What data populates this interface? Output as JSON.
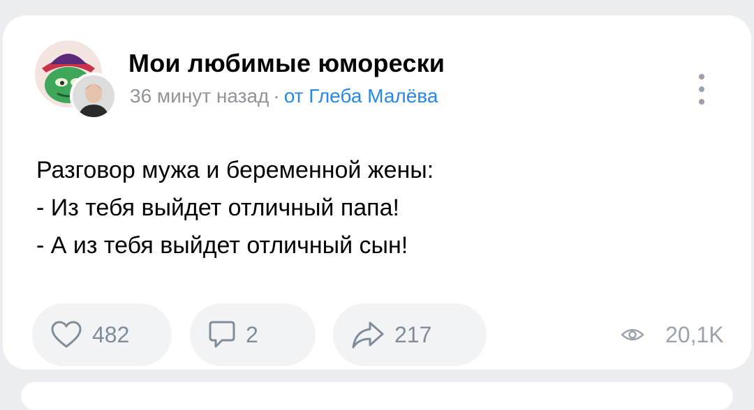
{
  "post": {
    "group_name": "Мои любимые юморески",
    "time": "36 минут назад",
    "separator": "·",
    "author": "от Глеба Малёва",
    "text_lines": [
      "Разговор мужа и беременной жены:",
      "- Из тебя выйдет отличный папа!",
      "- А из тебя выйдет отличный сын!"
    ]
  },
  "actions": {
    "likes": "482",
    "comments": "2",
    "shares": "217",
    "views": "20,1K"
  },
  "icons": {
    "like": "heart-outline-icon",
    "comment": "comment-bubble-icon",
    "share": "share-arrow-icon",
    "views": "eye-icon",
    "more": "vertical-dots-icon"
  },
  "colors": {
    "accent_link": "#2688eb",
    "secondary_text": "#909499",
    "pill_bg": "#f2f3f5",
    "page_bg": "#ebedf0"
  }
}
